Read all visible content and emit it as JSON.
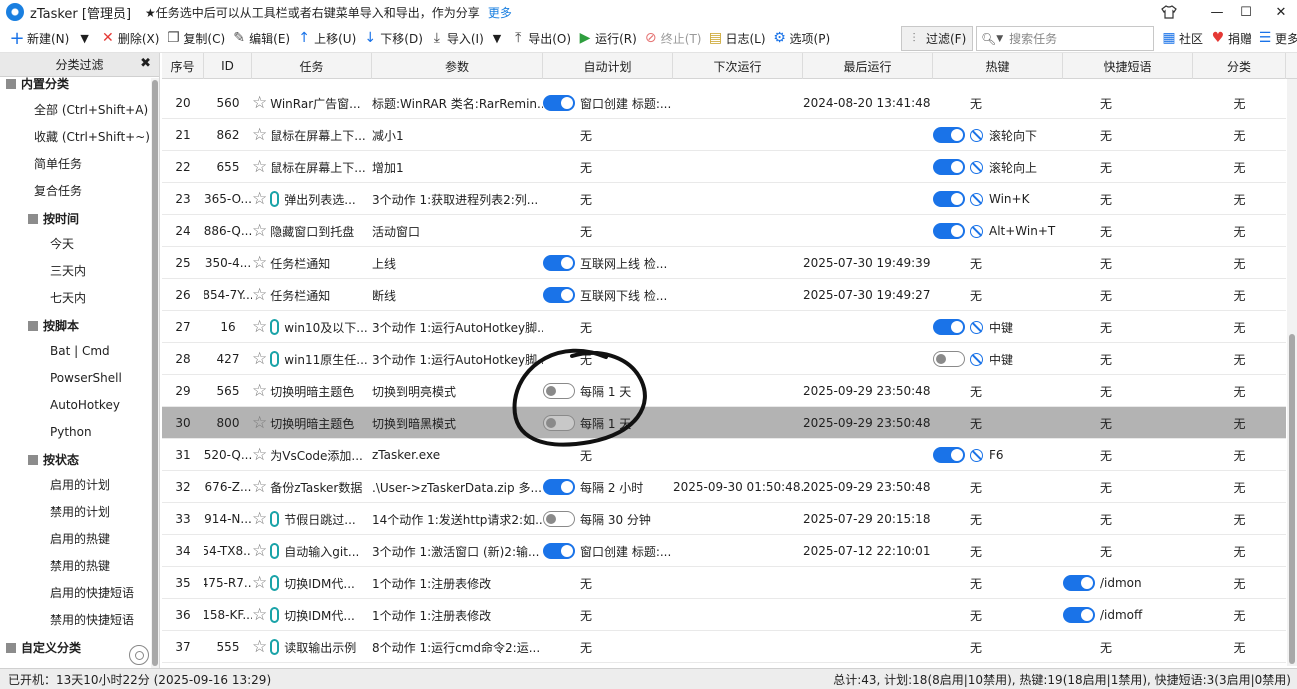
{
  "titlebar": {
    "app_title": "zTasker [管理员]",
    "notice": "★任务选中后可以从工具栏或者右键菜单导入和导出，作为分享",
    "more_link": "更多",
    "skin_icon": "shirt-icon",
    "minimize_glyph": "—",
    "maximize_glyph": "☐",
    "close_glyph": "✕"
  },
  "toolbar": {
    "new": "新建(N)",
    "dropdown": "▼",
    "delete": "删除(X)",
    "copy": "复制(C)",
    "edit": "编辑(E)",
    "move_up": "上移(U)",
    "move_down": "下移(D)",
    "import": "导入(I)",
    "import_dropdown": "▼",
    "export": "导出(O)",
    "run": "运行(R)",
    "stop": "终止(T)",
    "log": "日志(L)",
    "options": "选项(P)",
    "filter": "过滤(F)",
    "search_placeholder": "搜索任务",
    "community": "社区",
    "donate": "捐赠",
    "more": "更多"
  },
  "sidebar": {
    "title": "分类过滤",
    "close": "✖",
    "items": [
      {
        "label": "内置分类",
        "level": 0,
        "group": true
      },
      {
        "label": "全部 (Ctrl+Shift+A)",
        "level": 1
      },
      {
        "label": "收藏 (Ctrl+Shift+~)",
        "level": 1
      },
      {
        "label": "简单任务",
        "level": 1
      },
      {
        "label": "复合任务",
        "level": 1
      },
      {
        "label": "按时间",
        "level": 1,
        "group": true
      },
      {
        "label": "今天",
        "level": 2
      },
      {
        "label": "三天内",
        "level": 2
      },
      {
        "label": "七天内",
        "level": 2
      },
      {
        "label": "按脚本",
        "level": 1,
        "group": true
      },
      {
        "label": "Bat | Cmd",
        "level": 2
      },
      {
        "label": "PowserShell",
        "level": 2
      },
      {
        "label": "AutoHotkey",
        "level": 2
      },
      {
        "label": "Python",
        "level": 2
      },
      {
        "label": "按状态",
        "level": 1,
        "group": true
      },
      {
        "label": "启用的计划",
        "level": 2
      },
      {
        "label": "禁用的计划",
        "level": 2
      },
      {
        "label": "启用的热键",
        "level": 2
      },
      {
        "label": "禁用的热键",
        "level": 2
      },
      {
        "label": "启用的快捷短语",
        "level": 2
      },
      {
        "label": "禁用的快捷短语",
        "level": 2
      },
      {
        "label": "自定义分类",
        "level": 0,
        "group": true
      }
    ]
  },
  "table": {
    "columns": [
      "序号",
      "ID",
      "任务",
      "参数",
      "自动计划",
      "下次运行",
      "最后运行",
      "热键",
      "快捷短语",
      "分类"
    ],
    "rows": [
      {
        "seq": "20",
        "id": "560",
        "script": false,
        "task": "WinRar广告窗...",
        "params": "标题:WinRAR 类名:RarRemin...",
        "sched_toggle": "on",
        "sched": "窗口创建 标题:...",
        "next": "",
        "last": "2024-08-20 13:41:48",
        "hk_toggle": "",
        "hotkey": "无",
        "ph_toggle": "",
        "phrase": "无",
        "category": "无"
      },
      {
        "seq": "21",
        "id": "862",
        "script": false,
        "task": "鼠标在屏幕上下...",
        "params": "减小1",
        "sched_toggle": "",
        "sched": "无",
        "next": "",
        "last": "",
        "hk_toggle": "on",
        "hotkey": "滚轮向下",
        "ph_toggle": "",
        "phrase": "无",
        "category": "无"
      },
      {
        "seq": "22",
        "id": "655",
        "script": false,
        "task": "鼠标在屏幕上下...",
        "params": "增加1",
        "sched_toggle": "",
        "sched": "无",
        "next": "",
        "last": "",
        "hk_toggle": "on",
        "hotkey": "滚轮向上",
        "ph_toggle": "",
        "phrase": "无",
        "category": "无"
      },
      {
        "seq": "23",
        "id": "365-O...",
        "script": true,
        "task": "弹出列表选...",
        "params": "3个动作 1:获取进程列表2:列...",
        "sched_toggle": "",
        "sched": "无",
        "next": "",
        "last": "",
        "hk_toggle": "on",
        "hotkey": "Win+K",
        "ph_toggle": "",
        "phrase": "无",
        "category": "无"
      },
      {
        "seq": "24",
        "id": "886-Q...",
        "script": false,
        "task": "隐藏窗口到托盘",
        "params": "活动窗口",
        "sched_toggle": "",
        "sched": "无",
        "next": "",
        "last": "",
        "hk_toggle": "on",
        "hotkey": "Alt+Win+T",
        "ph_toggle": "",
        "phrase": "无",
        "category": "无"
      },
      {
        "seq": "25",
        "id": "350-4...",
        "script": false,
        "task": "任务栏通知",
        "params": "上线",
        "sched_toggle": "on",
        "sched": "互联网上线 检...",
        "next": "",
        "last": "2025-07-30 19:49:39",
        "hk_toggle": "",
        "hotkey": "无",
        "ph_toggle": "",
        "phrase": "无",
        "category": "无"
      },
      {
        "seq": "26",
        "id": "854-7Y...",
        "script": false,
        "task": "任务栏通知",
        "params": "断线",
        "sched_toggle": "on",
        "sched": "互联网下线 检...",
        "next": "",
        "last": "2025-07-30 19:49:27",
        "hk_toggle": "",
        "hotkey": "无",
        "ph_toggle": "",
        "phrase": "无",
        "category": "无"
      },
      {
        "seq": "27",
        "id": "16",
        "script": true,
        "task": "win10及以下...",
        "params": "3个动作 1:运行AutoHotkey脚...",
        "sched_toggle": "",
        "sched": "无",
        "next": "",
        "last": "",
        "hk_toggle": "on",
        "hotkey": "中键",
        "ph_toggle": "",
        "phrase": "无",
        "category": "无"
      },
      {
        "seq": "28",
        "id": "427",
        "script": true,
        "task": "win11原生任...",
        "params": "3个动作 1:运行AutoHotkey脚...",
        "sched_toggle": "",
        "sched": "无",
        "next": "",
        "last": "",
        "hk_toggle": "off",
        "hotkey": "中键",
        "ph_toggle": "",
        "phrase": "无",
        "category": "无"
      },
      {
        "seq": "29",
        "id": "565",
        "script": false,
        "task": "切换明暗主题色",
        "params": "切换到明亮模式",
        "sched_toggle": "off",
        "sched": "每隔 1 天",
        "next": "",
        "last": "2025-09-29 23:50:48",
        "hk_toggle": "",
        "hotkey": "无",
        "ph_toggle": "",
        "phrase": "无",
        "category": "无"
      },
      {
        "seq": "30",
        "id": "800",
        "script": false,
        "task": "切换明暗主题色",
        "params": "切换到暗黑模式",
        "sched_toggle": "off",
        "sched": "每隔 1 天",
        "next": "",
        "last": "2025-09-29 23:50:48",
        "hk_toggle": "",
        "hotkey": "无",
        "ph_toggle": "",
        "phrase": "无",
        "category": "无",
        "selected": true
      },
      {
        "seq": "31",
        "id": "520-Q...",
        "script": false,
        "task": "为VsCode添加...",
        "params": "zTasker.exe",
        "sched_toggle": "",
        "sched": "无",
        "next": "",
        "last": "",
        "hk_toggle": "on",
        "hotkey": "F6",
        "ph_toggle": "",
        "phrase": "无",
        "category": "无"
      },
      {
        "seq": "32",
        "id": "676-Z...",
        "script": false,
        "task": "备份zTasker数据",
        "params": ".\\User->zTaskerData.zip 多...",
        "sched_toggle": "on",
        "sched": "每隔 2 小时",
        "next": "2025-09-30 01:50:48...",
        "last": "2025-09-29 23:50:48",
        "hk_toggle": "",
        "hotkey": "无",
        "ph_toggle": "",
        "phrase": "无",
        "category": "无"
      },
      {
        "seq": "33",
        "id": "914-N...",
        "script": true,
        "task": "节假日跳过...",
        "params": "14个动作 1:发送http请求2:如...",
        "sched_toggle": "off",
        "sched": "每隔 30 分钟",
        "next": "",
        "last": "2025-07-29 20:15:18",
        "hk_toggle": "",
        "hotkey": "无",
        "ph_toggle": "",
        "phrase": "无",
        "category": "无"
      },
      {
        "seq": "34",
        "id": "54-TX8...",
        "script": true,
        "task": "自动输入git...",
        "params": "3个动作 1:激活窗口 (新)2:输...",
        "sched_toggle": "on",
        "sched": "窗口创建 标题:...",
        "next": "",
        "last": "2025-07-12 22:10:01",
        "hk_toggle": "",
        "hotkey": "无",
        "ph_toggle": "",
        "phrase": "无",
        "category": "无"
      },
      {
        "seq": "35",
        "id": "475-R7...",
        "script": true,
        "task": "切换IDM代...",
        "params": "1个动作 1:注册表修改",
        "sched_toggle": "",
        "sched": "无",
        "next": "",
        "last": "",
        "hk_toggle": "",
        "hotkey": "无",
        "ph_toggle": "on",
        "phrase": "/idmon",
        "category": "无"
      },
      {
        "seq": "36",
        "id": "158-KF...",
        "script": true,
        "task": "切换IDM代...",
        "params": "1个动作 1:注册表修改",
        "sched_toggle": "",
        "sched": "无",
        "next": "",
        "last": "",
        "hk_toggle": "",
        "hotkey": "无",
        "ph_toggle": "on",
        "phrase": "/idmoff",
        "category": "无"
      },
      {
        "seq": "37",
        "id": "555",
        "script": true,
        "task": "读取输出示例",
        "params": "8个动作 1:运行cmd命令2:运...",
        "sched_toggle": "",
        "sched": "无",
        "next": "",
        "last": "",
        "hk_toggle": "",
        "hotkey": "无",
        "ph_toggle": "",
        "phrase": "无",
        "category": "无"
      }
    ]
  },
  "statusbar": {
    "uptime": "已开机：13天10小时22分 (2025-09-16 13:29)",
    "summary": "总计:43, 计划:18(8启用|10禁用), 热键:19(18启用|1禁用), 快捷短语:3(3启用|0禁用)"
  },
  "colors": {
    "accent": "#1a73e8",
    "selected_row": "#b3b3b3",
    "delete_icon": "#e53935",
    "run_icon": "#2e9e3e",
    "donate_icon": "#e53935"
  }
}
